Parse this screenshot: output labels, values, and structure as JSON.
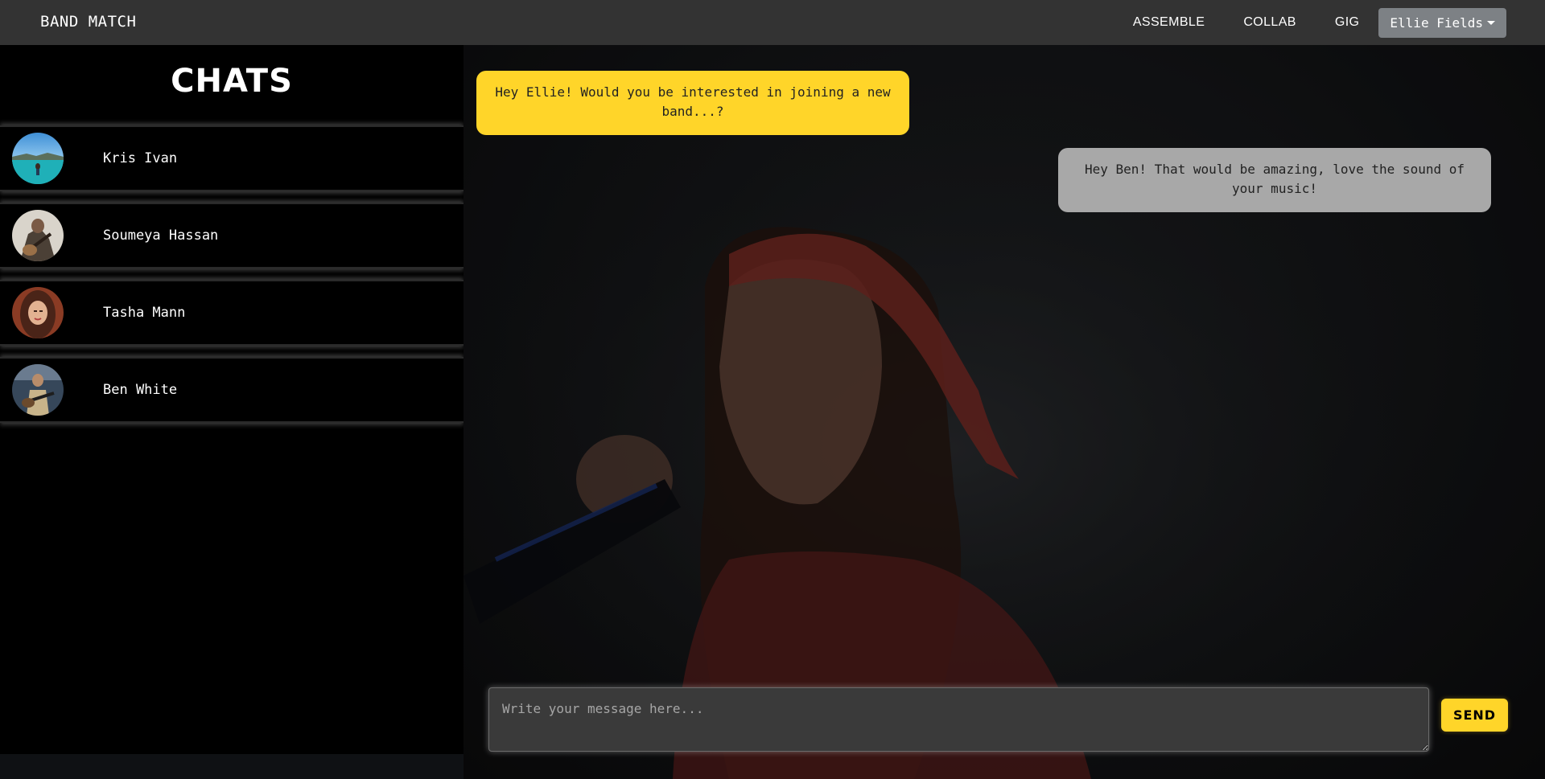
{
  "navbar": {
    "brand": "BAND MATCH",
    "links": [
      "ASSEMBLE",
      "COLLAB",
      "GIG"
    ],
    "user": "Ellie Fields"
  },
  "sidebar": {
    "title": "CHATS",
    "chats": [
      {
        "name": "Kris Ivan",
        "avatar": "beach-swimmer-avatar"
      },
      {
        "name": "Soumeya Hassan",
        "avatar": "guitarist-avatar"
      },
      {
        "name": "Tasha Mann",
        "avatar": "woman-portrait-avatar"
      },
      {
        "name": "Ben White",
        "avatar": "bassist-avatar"
      }
    ]
  },
  "messages": [
    {
      "from": "incoming",
      "text": "Hey Ellie! Would you be interested in joining a new band...?"
    },
    {
      "from": "outgoing",
      "text": "Hey Ben! That would be amazing, love the sound of your music!"
    }
  ],
  "composer": {
    "placeholder": "Write your message here...",
    "value": "",
    "send_label": "SEND"
  },
  "colors": {
    "accent": "#ffd529",
    "navbar": "#333333",
    "outgoing_bubble": "#a8a8a8",
    "user_button": "#7d8185"
  }
}
